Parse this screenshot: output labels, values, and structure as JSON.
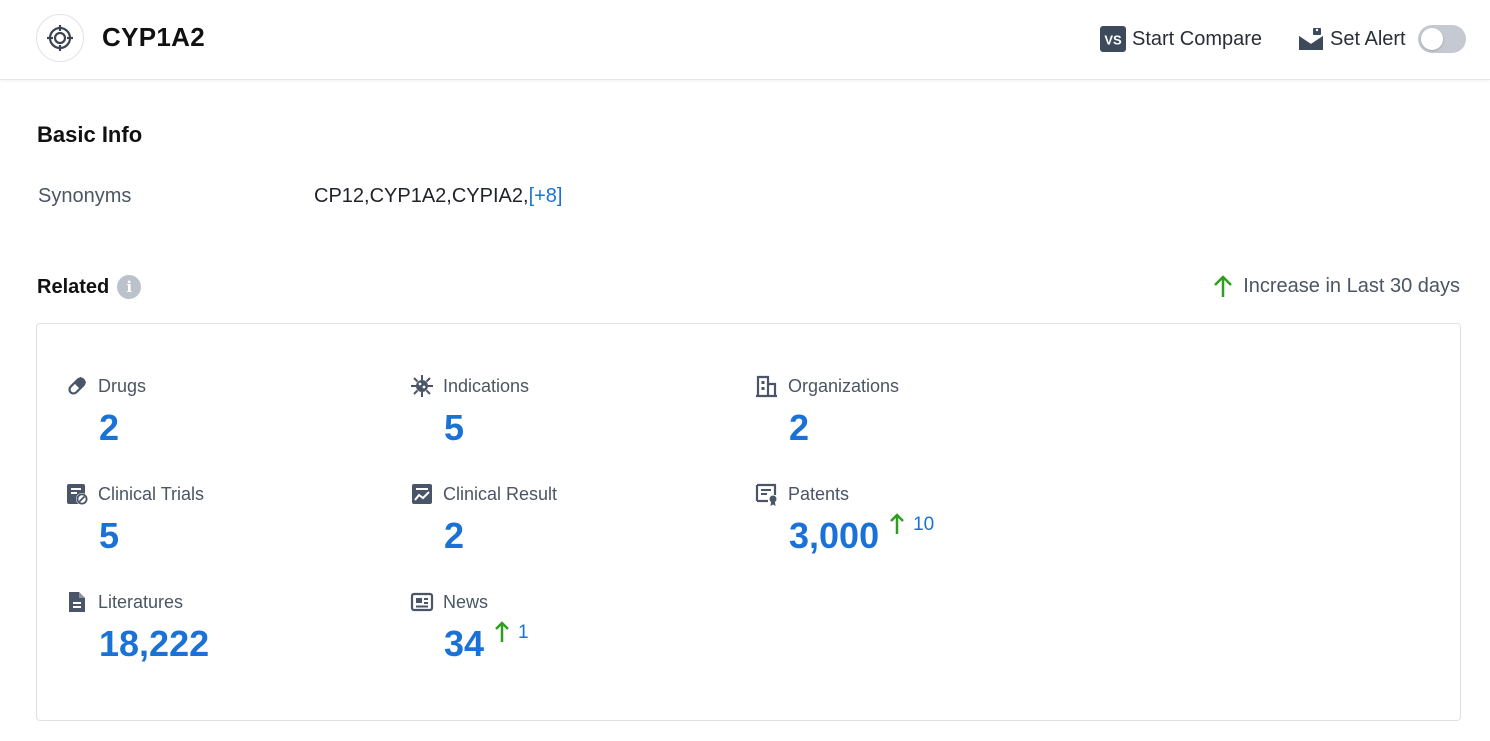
{
  "header": {
    "title": "CYP1A2",
    "compare_label": "Start Compare",
    "compare_badge": "VS",
    "alert_label": "Set Alert",
    "alert_enabled": false
  },
  "basic_info": {
    "title": "Basic Info",
    "synonyms_label": "Synonyms",
    "synonyms_value": "CP12,CYP1A2,CYPIA2,",
    "synonyms_more": "[+8]"
  },
  "related": {
    "title": "Related",
    "info_glyph": "i",
    "legend_label": "Increase in Last 30 days",
    "items": [
      {
        "label": "Drugs",
        "value": "2",
        "delta": "",
        "icon": "pill-icon"
      },
      {
        "label": "Indications",
        "value": "5",
        "delta": "",
        "icon": "virus-icon"
      },
      {
        "label": "Organizations",
        "value": "2",
        "delta": "",
        "icon": "building-icon"
      },
      {
        "label": "Clinical Trials",
        "value": "5",
        "delta": "",
        "icon": "clinical-trial-icon"
      },
      {
        "label": "Clinical Result",
        "value": "2",
        "delta": "",
        "icon": "chart-report-icon"
      },
      {
        "label": "Patents",
        "value": "3,000",
        "delta": "10",
        "icon": "patent-certificate-icon"
      },
      {
        "label": "Literatures",
        "value": "18,222",
        "delta": "",
        "icon": "document-icon"
      },
      {
        "label": "News",
        "value": "34",
        "delta": "1",
        "icon": "newspaper-icon"
      }
    ]
  },
  "colors": {
    "accent": "#1b72d6",
    "increase": "#2e9e1f",
    "icon": "#4a5568"
  }
}
